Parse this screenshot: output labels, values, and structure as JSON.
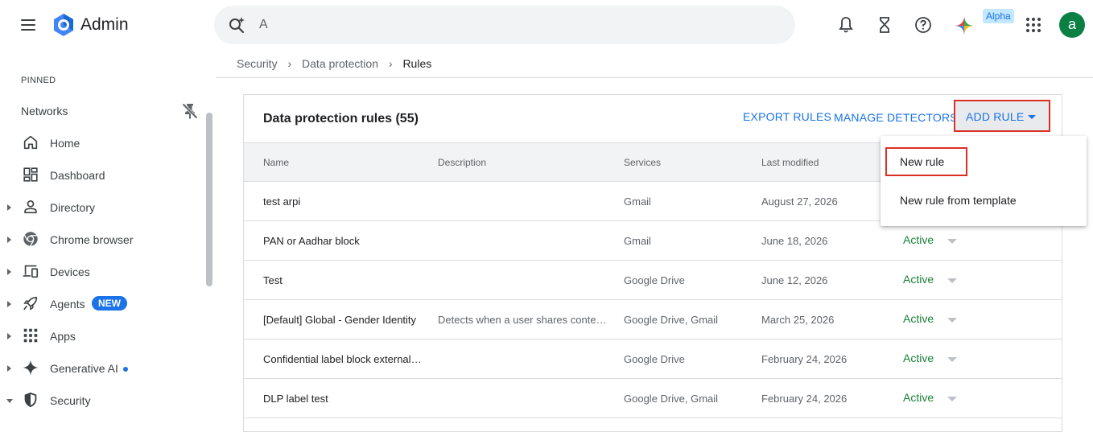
{
  "header": {
    "app_title": "Admin",
    "search_value": "A",
    "alpha_badge": "Alpha",
    "avatar_letter": "a",
    "colors": {
      "accent": "#1a73e8",
      "avatar": "#0b8043",
      "highlight": "#d93025"
    }
  },
  "sidebar": {
    "pinned_label": "PINNED",
    "networks_label": "Networks",
    "items": [
      {
        "label": "Home",
        "icon": "home-icon"
      },
      {
        "label": "Dashboard",
        "icon": "dashboard-icon"
      },
      {
        "label": "Directory",
        "icon": "person-icon"
      },
      {
        "label": "Chrome browser",
        "icon": "chrome-icon"
      },
      {
        "label": "Devices",
        "icon": "devices-icon"
      },
      {
        "label": "Agents",
        "icon": "rocket-icon",
        "badge": "NEW"
      },
      {
        "label": "Apps",
        "icon": "apps-grid-icon"
      },
      {
        "label": "Generative AI",
        "icon": "sparkle-icon"
      },
      {
        "label": "Security",
        "icon": "shield-icon"
      }
    ]
  },
  "breadcrumb": {
    "items": [
      "Security",
      "Data protection"
    ],
    "current": "Rules"
  },
  "card": {
    "title": "Data protection rules (55)",
    "export_label": "EXPORT RULES",
    "manage_label": "MANAGE DETECTORS",
    "add_rule_label": "ADD RULE"
  },
  "table": {
    "columns": [
      "Name",
      "Description",
      "Services",
      "Last modified"
    ],
    "rows": [
      {
        "name": "test arpi",
        "description": "",
        "services": "Gmail",
        "modified": "August 27, 2026",
        "status": ""
      },
      {
        "name": "PAN or Aadhar block",
        "description": "",
        "services": "Gmail",
        "modified": "June 18, 2026",
        "status": "Active"
      },
      {
        "name": "Test",
        "description": "",
        "services": "Google Drive",
        "modified": "June 12, 2026",
        "status": "Active"
      },
      {
        "name": "[Default] Global - Gender Identity",
        "description": "Detects when a user shares conten…",
        "services": "Google Drive, Gmail",
        "modified": "March 25, 2026",
        "status": "Active"
      },
      {
        "name": "Confidential label block external …",
        "description": "",
        "services": "Google Drive",
        "modified": "February 24, 2026",
        "status": "Active"
      },
      {
        "name": "DLP label test",
        "description": "",
        "services": "Google Drive, Gmail",
        "modified": "February 24, 2026",
        "status": "Active"
      }
    ]
  },
  "dropdown": {
    "items": [
      "New rule",
      "New rule from template"
    ]
  }
}
